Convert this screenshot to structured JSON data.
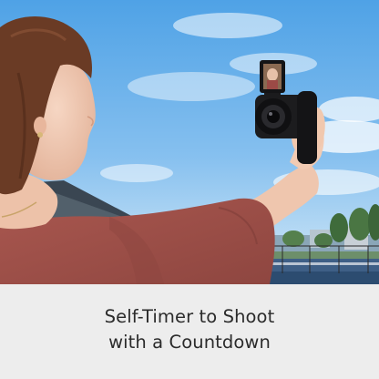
{
  "caption": {
    "line1": "Self-Timer to Shoot",
    "line2": "with a Countdown"
  },
  "colors": {
    "sky_top": "#5aa9e8",
    "sky_bottom": "#cfe6f6",
    "shirt": "#a0504c",
    "hair": "#6b3d27",
    "skin": "#f3cdb7",
    "camera": "#1d1d1f",
    "caption_bg": "#ededed",
    "caption_text": "#2b2b2b"
  },
  "icons": {
    "camera": "camera-icon"
  }
}
